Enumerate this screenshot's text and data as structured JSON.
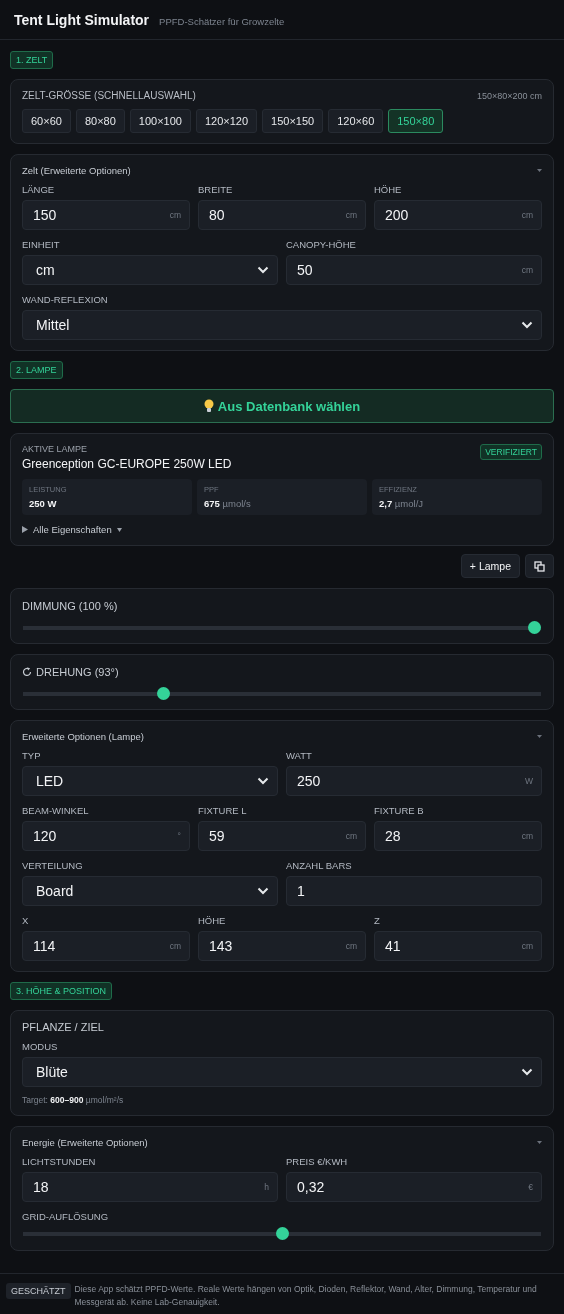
{
  "header": {
    "title": "Tent Light Simulator",
    "subtitle": "PPFD-Schätzer für Growzelte"
  },
  "tent": {
    "badge": "1. ZELT",
    "quick": {
      "label": "ZELT-GRÖSSE (SCHNELLAUSWAHL)",
      "summary": "150×80×200 cm",
      "presets": [
        {
          "label": "60×60",
          "selected": false
        },
        {
          "label": "80×80",
          "selected": false
        },
        {
          "label": "100×100",
          "selected": false
        },
        {
          "label": "120×120",
          "selected": false
        },
        {
          "label": "150×150",
          "selected": false
        },
        {
          "label": "120×60",
          "selected": false
        },
        {
          "label": "150×80",
          "selected": true
        }
      ]
    },
    "advanced": {
      "title": "Zelt (Erweiterte Optionen)",
      "expanded": true,
      "rows": [
        [
          {
            "kind": "input",
            "label": "LÄNGE",
            "value": "150",
            "unit": "cm"
          },
          {
            "kind": "input",
            "label": "BREITE",
            "value": "80",
            "unit": "cm"
          },
          {
            "kind": "input",
            "label": "HÖHE",
            "value": "200",
            "unit": "cm"
          }
        ],
        [
          {
            "kind": "select",
            "label": "EINHEIT",
            "value": "cm"
          },
          {
            "kind": "input",
            "label": "CANOPY-HÖHE",
            "value": "50",
            "unit": "cm"
          }
        ],
        [
          {
            "kind": "select",
            "label": "WAND-REFLEXION",
            "value": "Mittel"
          }
        ]
      ]
    }
  },
  "lamp": {
    "badge": "2. LAMPE",
    "db_button": "Aus Datenbank wählen",
    "active": {
      "label": "AKTIVE LAMPE",
      "name": "Greenception GC-EUROPE 250W LED",
      "verified": "VERIFIZIERT",
      "stats": [
        {
          "label": "LEISTUNG",
          "value": "250 W"
        },
        {
          "label": "PPF",
          "value": "675",
          "unit": "µmol/s"
        },
        {
          "label": "EFFIZIENZ",
          "value": "2,7",
          "unit": "µmol/J"
        }
      ],
      "details": "Alle Eigenschaften",
      "details_expanded": false
    },
    "add_button": "+ Lampe",
    "sliders": [
      {
        "label": "DIMMUNG (100 %)",
        "icon": false,
        "level": 1.0
      },
      {
        "label": "DREHUNG (93°)",
        "icon": true,
        "level": 0.266
      }
    ],
    "advanced": {
      "title": "Erweiterte Optionen (Lampe)",
      "expanded": true,
      "rows": [
        [
          {
            "kind": "select",
            "label": "TYP",
            "value": "LED"
          },
          {
            "kind": "input",
            "label": "WATT",
            "value": "250",
            "unit": "W"
          }
        ],
        [
          {
            "kind": "input",
            "label": "BEAM-WINKEL",
            "value": "120",
            "unit": "°"
          },
          {
            "kind": "input",
            "label": "FIXTURE L",
            "value": "59",
            "unit": "cm"
          },
          {
            "kind": "input",
            "label": "FIXTURE B",
            "value": "28",
            "unit": "cm"
          }
        ],
        [
          {
            "kind": "select",
            "label": "VERTEILUNG",
            "value": "Board"
          },
          {
            "kind": "input",
            "label": "ANZAHL BARS",
            "value": "1"
          }
        ],
        [
          {
            "kind": "input",
            "label": "X",
            "value": "114",
            "unit": "cm"
          },
          {
            "kind": "input",
            "label": "HÖHE",
            "value": "143",
            "unit": "cm"
          },
          {
            "kind": "input",
            "label": "Z",
            "value": "41",
            "unit": "cm"
          }
        ]
      ]
    }
  },
  "position": {
    "badge": "3. HÖHE & POSITION",
    "plant": {
      "title": "PFLANZE / ZIEL",
      "mode_label": "MODUS",
      "mode": "Blüte",
      "target": "Target: **600–900** µmol/m²/s"
    },
    "energy": {
      "title": "Energie (Erweiterte Optionen)",
      "expanded": true,
      "rows": [
        [
          {
            "kind": "input",
            "label": "LICHTSTUNDEN",
            "value": "18",
            "unit": "h"
          },
          {
            "kind": "input",
            "label": "PREIS €/KWH",
            "value": "0,32",
            "unit": "€"
          }
        ],
        [
          {
            "kind": "slider",
            "label": "GRID-AUFLÖSUNG",
            "level": 0.5
          }
        ]
      ]
    }
  },
  "footer": {
    "badge": "GESCHÄTZT",
    "text": "Diese App schätzt PPFD-Werte. Reale Werte hängen von Optik, Dioden, Reflektor, Wand, Alter, Dimmung, Temperatur und Messgerät ab. Keine Lab-Genauigkeit."
  }
}
